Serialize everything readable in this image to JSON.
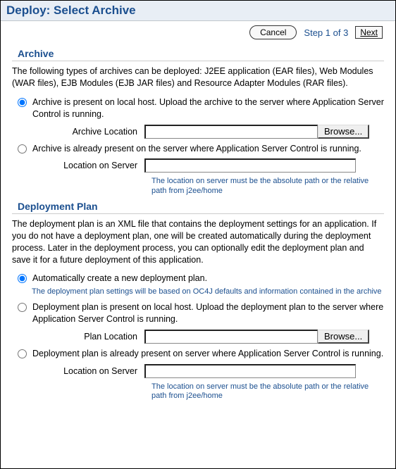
{
  "page_title": "Deploy: Select Archive",
  "topbar": {
    "cancel_label": "Cancel",
    "step_text": "Step 1 of 3",
    "next_label": "Next"
  },
  "archive": {
    "heading": "Archive",
    "description": "The following types of archives can be deployed: J2EE application (EAR files), Web Modules (WAR files), EJB Modules (EJB JAR files) and Resource Adapter Modules  (RAR files).",
    "opt_local_label": "Archive is present on local host. Upload the archive to the server where Application Server Control is running.",
    "archive_location_label": "Archive Location",
    "archive_location_value": "",
    "browse_label": "Browse...",
    "opt_server_label": "Archive is already present on the server where Application Server Control is running.",
    "location_on_server_label": "Location on Server",
    "location_on_server_value": "",
    "server_hint": "The location on server must be the absolute path or the relative path from j2ee/home"
  },
  "plan": {
    "heading": "Deployment Plan",
    "description": "The deployment plan is an XML file that contains the deployment settings for an application. If you do not have a deployment plan, one will be created automatically during the deployment process. Later in the deployment process, you can optionally edit the deployment plan and save it for a future deployment of this application.",
    "opt_auto_label": "Automatically create a new deployment plan.",
    "auto_hint": "The deployment plan settings will be based on OC4J defaults and information contained in the archive",
    "opt_local_label": "Deployment plan is present on local host. Upload the deployment plan to the server where Application Server Control is running.",
    "plan_location_label": "Plan Location",
    "plan_location_value": "",
    "browse_label": "Browse...",
    "opt_server_label": "Deployment plan is already present on server where Application Server Control is running.",
    "location_on_server_label": "Location on Server",
    "location_on_server_value": "",
    "server_hint": "The location on server must be the absolute path or the relative path from j2ee/home"
  }
}
